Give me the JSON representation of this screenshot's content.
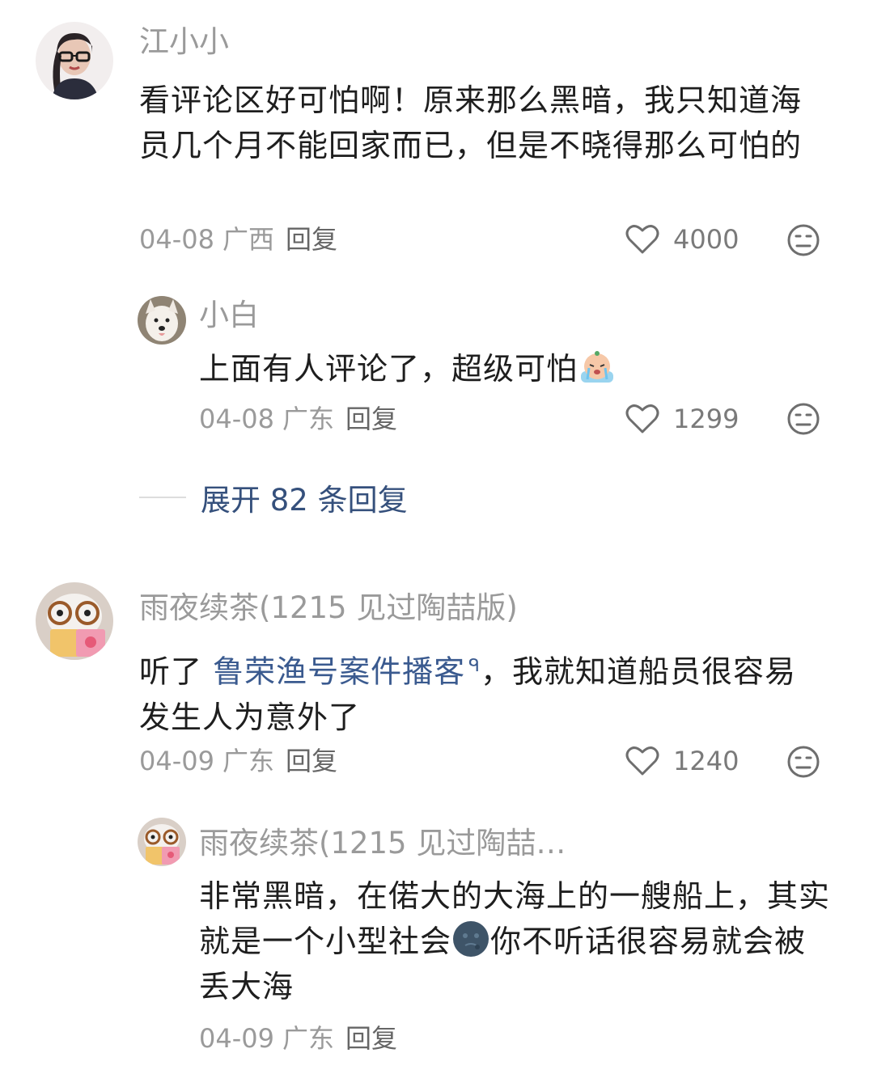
{
  "comments": [
    {
      "author": "江小小",
      "text": "看评论区好可怕啊！原来那么黑暗，我只知道海员几个月不能回家而已，但是不晓得那么可怕的",
      "date": "04-08",
      "region": "广西",
      "reply_label": "回复",
      "likes": "4000"
    },
    {
      "author": "小白",
      "text": "上面有人评论了，超级可怕",
      "date": "04-08",
      "region": "广东",
      "reply_label": "回复",
      "likes": "1299"
    },
    {
      "author": "雨夜续茶(1215 见过陶喆版)",
      "text_before": "听了 ",
      "link_text": "鲁荣渔号案件播客",
      "text_after": "，我就知道船员很容易发生人为意外了",
      "date": "04-09",
      "region": "广东",
      "reply_label": "回复",
      "likes": "1240"
    },
    {
      "author": "雨夜续茶(1215 见过陶喆…",
      "text_before": "非常黑暗，在偌大的大海上的一艘船上，其实就是一个小型社会",
      "text_after": "你不听话很容易就会被丢大海",
      "date": "04-09",
      "region": "广东",
      "reply_label": "回复"
    }
  ],
  "expand_replies": "展开 82 条回复",
  "icons": {
    "like": "heart-outline-icon",
    "dislike": "meh-face-icon",
    "emoji_cry": "crying-face-emoji",
    "emoji_moon": "new-moon-face-emoji",
    "link": "search-link-icon"
  },
  "colors": {
    "name": "#9a9a9a",
    "link": "#3a5a8f",
    "expand": "#35507c"
  }
}
